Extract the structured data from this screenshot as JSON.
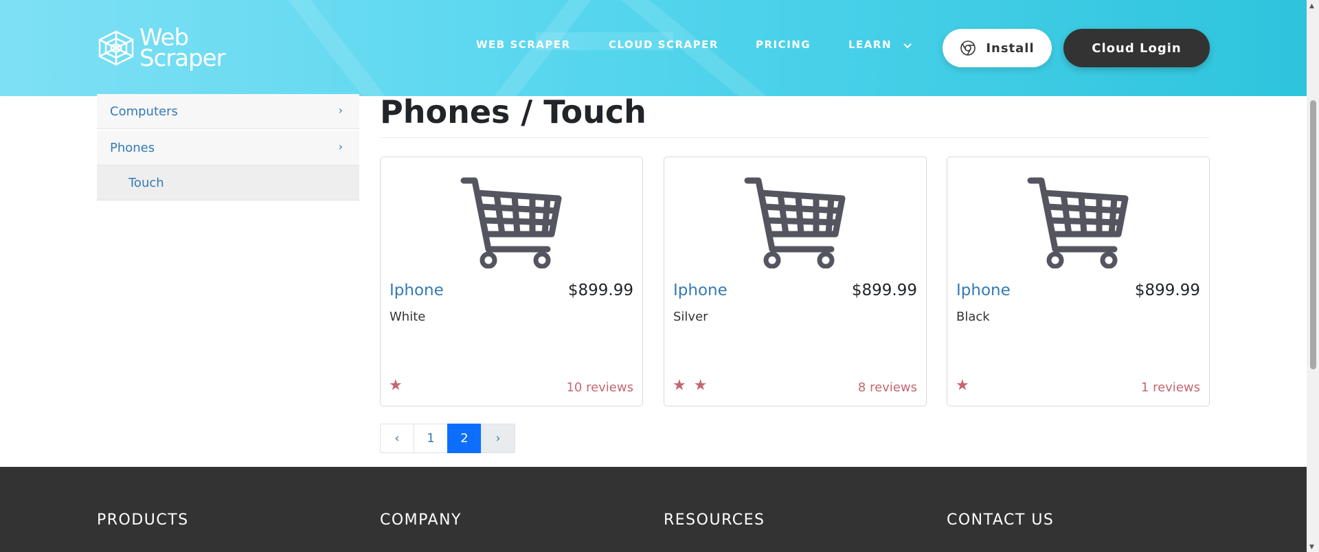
{
  "header": {
    "logo_line1": "Web",
    "logo_line2": "Scraper",
    "nav": [
      "WEB SCRAPER",
      "CLOUD SCRAPER",
      "PRICING",
      "LEARN"
    ],
    "install_label": "Install",
    "login_label": "Cloud Login"
  },
  "sidebar": {
    "items": [
      {
        "label": "Computers",
        "arrow": "›"
      },
      {
        "label": "Phones",
        "arrow": "›"
      }
    ],
    "sub_item": "Touch"
  },
  "main": {
    "title": "Phones / Touch",
    "products": [
      {
        "name": "Iphone",
        "price": "$899.99",
        "description": "White",
        "rating": 1,
        "stars": "★",
        "reviews": "10 reviews"
      },
      {
        "name": "Iphone",
        "price": "$899.99",
        "description": "Silver",
        "rating": 2,
        "stars": "★ ★",
        "reviews": "8 reviews"
      },
      {
        "name": "Iphone",
        "price": "$899.99",
        "description": "Black",
        "rating": 1,
        "stars": "★",
        "reviews": "1 reviews"
      }
    ],
    "pagination": {
      "prev": "‹",
      "pages": [
        "1",
        "2"
      ],
      "active_page": "2",
      "next": "›"
    }
  },
  "footer": {
    "columns": [
      "PRODUCTS",
      "COMPANY",
      "RESOURCES",
      "CONTACT US"
    ]
  },
  "colors": {
    "header_gradient_start": "#7fe0f5",
    "header_gradient_end": "#2ec4dd",
    "link": "#337ab7",
    "star": "#c4676f",
    "active_page": "#0d6efd",
    "footer_bg": "#333333"
  }
}
